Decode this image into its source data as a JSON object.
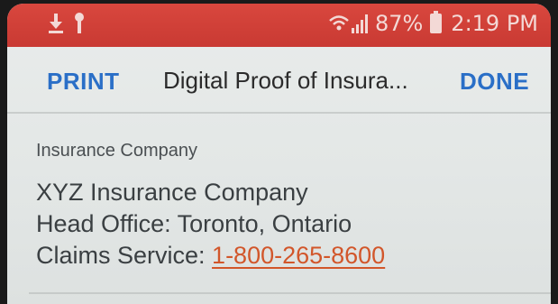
{
  "status_bar": {
    "battery": "87%",
    "time": "2:19 PM",
    "icons": [
      "download-icon",
      "key-icon",
      "wifi-signal-icon",
      "battery-icon"
    ],
    "background_color": "#d9473e"
  },
  "nav": {
    "print_label": "PRINT",
    "title": "Digital Proof of Insura...",
    "done_label": "DONE",
    "accent_color": "#2a6fc7"
  },
  "content": {
    "section_label": "Insurance Company",
    "company_name": "XYZ Insurance Company",
    "head_office": "Head Office:  Toronto, Ontario",
    "claims_label": "Claims Service: ",
    "claims_phone": "1-800-265-8600",
    "link_color": "#d2562a"
  }
}
